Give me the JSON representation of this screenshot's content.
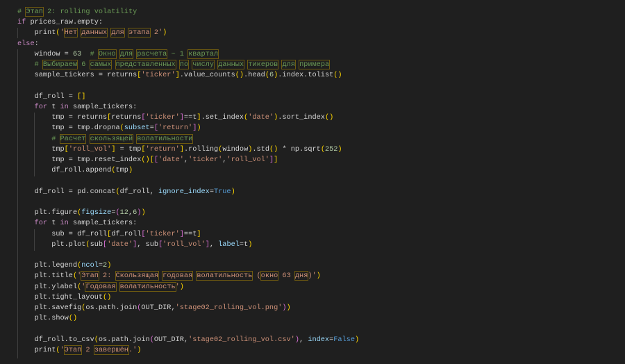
{
  "editor": {
    "language": "python",
    "theme_colors": {
      "background": "#1f1f1f",
      "keyword": "#c586c0",
      "string": "#ce9178",
      "comment": "#6a9955",
      "number": "#b5cea8",
      "highlight_box": "#6e5a10"
    }
  },
  "lines": [
    [
      [
        "c",
        "# "
      ],
      [
        "cx",
        "Этап"
      ],
      [
        "c",
        " 2: rolling volatility"
      ]
    ],
    [
      [
        "k",
        "if"
      ],
      [
        "t",
        " prices_raw.empty:"
      ]
    ],
    [
      [
        "t",
        "    print"
      ],
      [
        "b1",
        "("
      ],
      [
        "s",
        "'"
      ],
      [
        "sx",
        "Нет"
      ],
      [
        "s",
        " "
      ],
      [
        "sx",
        "данных"
      ],
      [
        "s",
        " "
      ],
      [
        "sx",
        "для"
      ],
      [
        "s",
        " "
      ],
      [
        "sx",
        "этапа"
      ],
      [
        "s",
        " 2'"
      ],
      [
        "b1",
        ")"
      ]
    ],
    [
      [
        "k",
        "else"
      ],
      [
        "t",
        ":"
      ]
    ],
    [
      [
        "t",
        "    window = "
      ],
      [
        "n",
        "63"
      ],
      [
        "t",
        "  "
      ],
      [
        "c",
        "# "
      ],
      [
        "cx",
        "Окно"
      ],
      [
        "c",
        " "
      ],
      [
        "cx",
        "для"
      ],
      [
        "c",
        " "
      ],
      [
        "cx",
        "расчета"
      ],
      [
        "c",
        " ~ 1 "
      ],
      [
        "cx",
        "квартал"
      ]
    ],
    [
      [
        "t",
        "    "
      ],
      [
        "c",
        "# "
      ],
      [
        "cx",
        "Выбираем"
      ],
      [
        "c",
        " 6 "
      ],
      [
        "cx",
        "самых"
      ],
      [
        "c",
        " "
      ],
      [
        "cx",
        "представленных"
      ],
      [
        "c",
        " "
      ],
      [
        "cx",
        "по"
      ],
      [
        "c",
        " "
      ],
      [
        "cx",
        "числу"
      ],
      [
        "c",
        " "
      ],
      [
        "cx",
        "данных"
      ],
      [
        "c",
        " "
      ],
      [
        "cx",
        "тикеров"
      ],
      [
        "c",
        " "
      ],
      [
        "cx",
        "для"
      ],
      [
        "c",
        " "
      ],
      [
        "cx",
        "примера"
      ]
    ],
    [
      [
        "t",
        "    sample_tickers = returns"
      ],
      [
        "b1",
        "["
      ],
      [
        "s",
        "'ticker'"
      ],
      [
        "b1",
        "]"
      ],
      [
        "t",
        ".value_counts"
      ],
      [
        "b1",
        "()"
      ],
      [
        "t",
        ".head"
      ],
      [
        "b1",
        "("
      ],
      [
        "n",
        "6"
      ],
      [
        "b1",
        ")"
      ],
      [
        "t",
        ".index.tolist"
      ],
      [
        "b1",
        "()"
      ]
    ],
    [],
    [
      [
        "t",
        "    df_roll = "
      ],
      [
        "b1",
        "[]"
      ]
    ],
    [
      [
        "t",
        "    "
      ],
      [
        "k",
        "for"
      ],
      [
        "t",
        " t "
      ],
      [
        "k",
        "in"
      ],
      [
        "t",
        " sample_tickers:"
      ]
    ],
    [
      [
        "t",
        "        tmp = returns"
      ],
      [
        "b1",
        "["
      ],
      [
        "t",
        "returns"
      ],
      [
        "b2",
        "["
      ],
      [
        "s",
        "'ticker'"
      ],
      [
        "b2",
        "]"
      ],
      [
        "t",
        "==t"
      ],
      [
        "b1",
        "]"
      ],
      [
        "t",
        ".set_index"
      ],
      [
        "b1",
        "("
      ],
      [
        "s",
        "'date'"
      ],
      [
        "b1",
        ")"
      ],
      [
        "t",
        ".sort_index"
      ],
      [
        "b1",
        "()"
      ]
    ],
    [
      [
        "t",
        "        tmp = tmp.dropna"
      ],
      [
        "b1",
        "("
      ],
      [
        "p",
        "subset"
      ],
      [
        "t",
        "="
      ],
      [
        "b2",
        "["
      ],
      [
        "s",
        "'return'"
      ],
      [
        "b2",
        "]"
      ],
      [
        "b1",
        ")"
      ]
    ],
    [
      [
        "t",
        "        "
      ],
      [
        "c",
        "# "
      ],
      [
        "cx",
        "Расчет"
      ],
      [
        "c",
        " "
      ],
      [
        "cx",
        "скользящей"
      ],
      [
        "c",
        " "
      ],
      [
        "cx",
        "волатильности"
      ]
    ],
    [
      [
        "t",
        "        tmp"
      ],
      [
        "b1",
        "["
      ],
      [
        "s",
        "'roll_vol'"
      ],
      [
        "b1",
        "]"
      ],
      [
        "t",
        " = tmp"
      ],
      [
        "b1",
        "["
      ],
      [
        "s",
        "'return'"
      ],
      [
        "b1",
        "]"
      ],
      [
        "t",
        ".rolling"
      ],
      [
        "b1",
        "("
      ],
      [
        "t",
        "window"
      ],
      [
        "b1",
        ")"
      ],
      [
        "t",
        ".std"
      ],
      [
        "b1",
        "()"
      ],
      [
        "t",
        " * np.sqrt"
      ],
      [
        "b1",
        "("
      ],
      [
        "n",
        "252"
      ],
      [
        "b1",
        ")"
      ]
    ],
    [
      [
        "t",
        "        tmp = tmp.reset_index"
      ],
      [
        "b1",
        "()"
      ],
      [
        "b1",
        "["
      ],
      [
        "b2",
        "["
      ],
      [
        "s",
        "'date'"
      ],
      [
        "t",
        ","
      ],
      [
        "s",
        "'ticker'"
      ],
      [
        "t",
        ","
      ],
      [
        "s",
        "'roll_vol'"
      ],
      [
        "b2",
        "]"
      ],
      [
        "b1",
        "]"
      ]
    ],
    [
      [
        "t",
        "        df_roll.append"
      ],
      [
        "b1",
        "("
      ],
      [
        "t",
        "tmp"
      ],
      [
        "b1",
        ")"
      ]
    ],
    [],
    [
      [
        "t",
        "    df_roll = pd.concat"
      ],
      [
        "b1",
        "("
      ],
      [
        "t",
        "df_roll, "
      ],
      [
        "p",
        "ignore_index"
      ],
      [
        "t",
        "="
      ],
      [
        "kw",
        "True"
      ],
      [
        "b1",
        ")"
      ]
    ],
    [],
    [
      [
        "t",
        "    plt.figure"
      ],
      [
        "b1",
        "("
      ],
      [
        "p",
        "figsize"
      ],
      [
        "t",
        "="
      ],
      [
        "b2",
        "("
      ],
      [
        "n",
        "12"
      ],
      [
        "t",
        ","
      ],
      [
        "n",
        "6"
      ],
      [
        "b2",
        ")"
      ],
      [
        "b1",
        ")"
      ]
    ],
    [
      [
        "t",
        "    "
      ],
      [
        "k",
        "for"
      ],
      [
        "t",
        " t "
      ],
      [
        "k",
        "in"
      ],
      [
        "t",
        " sample_tickers:"
      ]
    ],
    [
      [
        "t",
        "        sub = df_roll"
      ],
      [
        "b1",
        "["
      ],
      [
        "t",
        "df_roll"
      ],
      [
        "b2",
        "["
      ],
      [
        "s",
        "'ticker'"
      ],
      [
        "b2",
        "]"
      ],
      [
        "t",
        "==t"
      ],
      [
        "b1",
        "]"
      ]
    ],
    [
      [
        "t",
        "        plt.plot"
      ],
      [
        "b1",
        "("
      ],
      [
        "t",
        "sub"
      ],
      [
        "b2",
        "["
      ],
      [
        "s",
        "'date'"
      ],
      [
        "b2",
        "]"
      ],
      [
        "t",
        ", sub"
      ],
      [
        "b2",
        "["
      ],
      [
        "s",
        "'roll_vol'"
      ],
      [
        "b2",
        "]"
      ],
      [
        "t",
        ", "
      ],
      [
        "p",
        "label"
      ],
      [
        "t",
        "=t"
      ],
      [
        "b1",
        ")"
      ]
    ],
    [],
    [
      [
        "t",
        "    plt.legend"
      ],
      [
        "b1",
        "("
      ],
      [
        "p",
        "ncol"
      ],
      [
        "t",
        "="
      ],
      [
        "n",
        "2"
      ],
      [
        "b1",
        ")"
      ]
    ],
    [
      [
        "t",
        "    plt.title"
      ],
      [
        "b1",
        "("
      ],
      [
        "s",
        "'"
      ],
      [
        "sx",
        "Этап"
      ],
      [
        "s",
        " 2: "
      ],
      [
        "sx",
        "Скользящая"
      ],
      [
        "s",
        " "
      ],
      [
        "sx",
        "годовая"
      ],
      [
        "s",
        " "
      ],
      [
        "sx",
        "волатильность"
      ],
      [
        "s",
        " ("
      ],
      [
        "sx",
        "окно"
      ],
      [
        "s",
        " 63 "
      ],
      [
        "sx",
        "дня"
      ],
      [
        "s",
        ")'"
      ],
      [
        "b1",
        ")"
      ]
    ],
    [
      [
        "t",
        "    plt.ylabel"
      ],
      [
        "b1",
        "("
      ],
      [
        "s",
        "'"
      ],
      [
        "sx",
        "Годовая"
      ],
      [
        "s",
        " "
      ],
      [
        "sx",
        "волатильность"
      ],
      [
        "s",
        "'"
      ],
      [
        "b1",
        ")"
      ]
    ],
    [
      [
        "t",
        "    plt.tight_layout"
      ],
      [
        "b1",
        "()"
      ]
    ],
    [
      [
        "t",
        "    plt.savefig"
      ],
      [
        "b1",
        "("
      ],
      [
        "t",
        "os.path.join"
      ],
      [
        "b2",
        "("
      ],
      [
        "t",
        "OUT_DIR,"
      ],
      [
        "s",
        "'stage02_rolling_vol.png'"
      ],
      [
        "b2",
        ")"
      ],
      [
        "b1",
        ")"
      ]
    ],
    [
      [
        "t",
        "    plt.show"
      ],
      [
        "b1",
        "()"
      ]
    ],
    [],
    [
      [
        "t",
        "    df_roll.to_csv"
      ],
      [
        "b1",
        "("
      ],
      [
        "t",
        "os.path.join"
      ],
      [
        "b2",
        "("
      ],
      [
        "t",
        "OUT_DIR,"
      ],
      [
        "s",
        "'stage02_rolling_vol.csv'"
      ],
      [
        "b2",
        ")"
      ],
      [
        "t",
        ", "
      ],
      [
        "p",
        "index"
      ],
      [
        "t",
        "="
      ],
      [
        "kw",
        "False"
      ],
      [
        "b1",
        ")"
      ]
    ],
    [
      [
        "t",
        "    print"
      ],
      [
        "b1",
        "("
      ],
      [
        "s",
        "'"
      ],
      [
        "sx",
        "Этап"
      ],
      [
        "s",
        " 2 "
      ],
      [
        "sx",
        "завершён"
      ],
      [
        "s",
        ".'"
      ],
      [
        "b1",
        ")"
      ]
    ]
  ]
}
